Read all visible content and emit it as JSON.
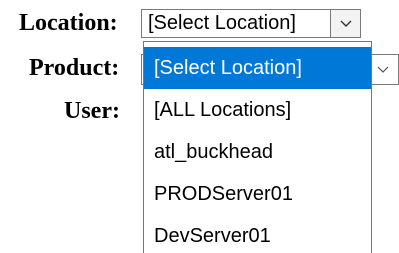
{
  "form": {
    "location": {
      "label": "Location:",
      "value": "[Select Location]",
      "icon": "chevron-down-icon"
    },
    "product": {
      "label": "Product:",
      "icon": "chevron-down-icon"
    },
    "user": {
      "label": "User:"
    }
  },
  "location_dropdown": {
    "options": [
      {
        "label": "[Select Location]",
        "selected": true
      },
      {
        "label": "[ALL Locations]",
        "selected": false
      },
      {
        "label": "atl_buckhead",
        "selected": false
      },
      {
        "label": "PRODServer01",
        "selected": false
      },
      {
        "label": "DevServer01",
        "selected": false
      }
    ]
  },
  "colors": {
    "selected_option_bg": "#0078d7",
    "selected_option_text": "#ffffff",
    "border": "#767676"
  }
}
